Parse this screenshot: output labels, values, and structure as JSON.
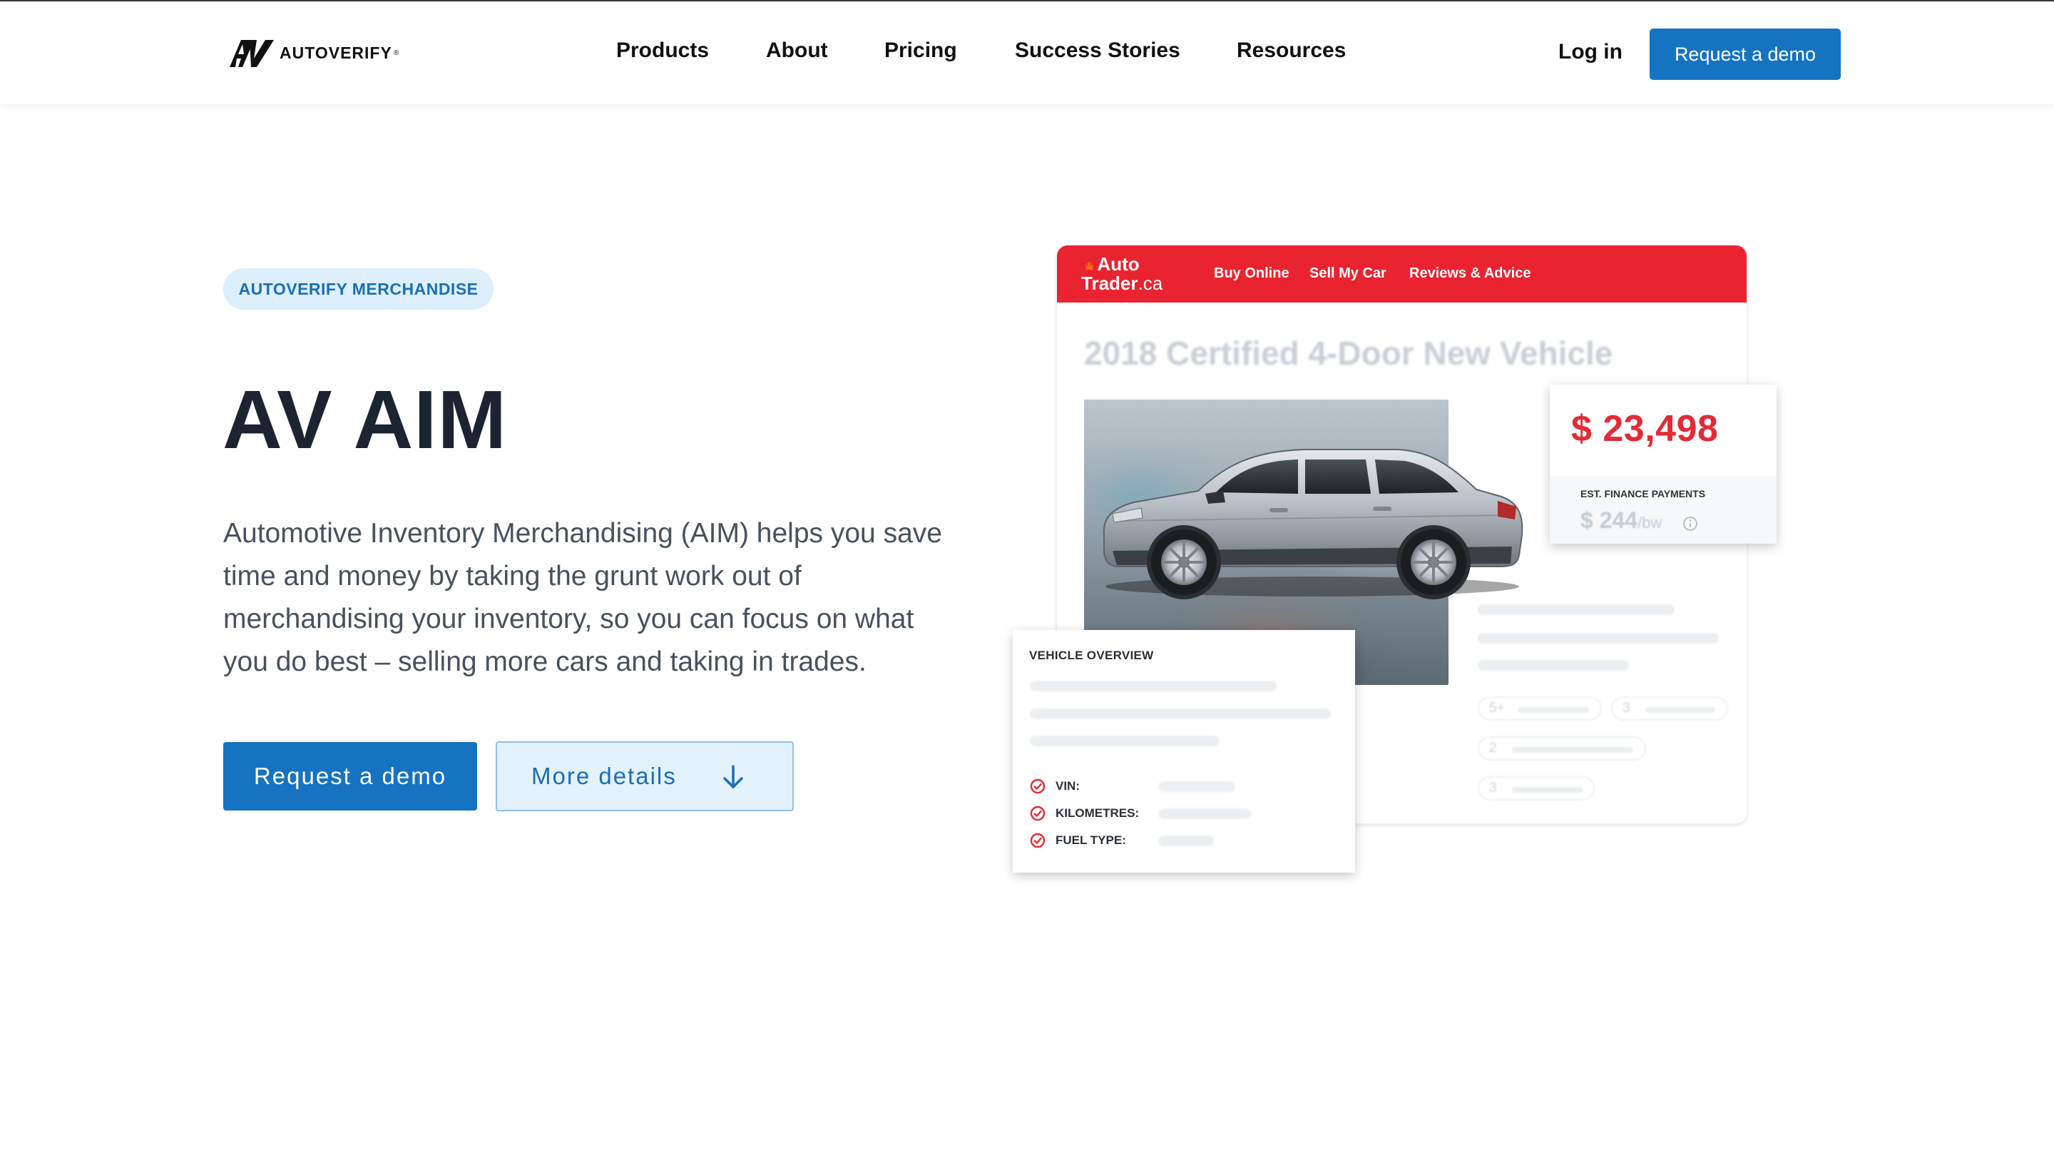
{
  "header": {
    "brand": "AUTOVERIFY",
    "nav": [
      {
        "label": "Products"
      },
      {
        "label": "About"
      },
      {
        "label": "Pricing"
      },
      {
        "label": "Success Stories"
      },
      {
        "label": "Resources"
      }
    ],
    "login_label": "Log in",
    "demo_label": "Request a demo"
  },
  "hero": {
    "badge": "AUTOVERIFY MERCHANDISE",
    "title": "AV AIM",
    "description": "Automotive Inventory Merchandising (AIM) helps you save time and money by taking the grunt work out of merchandising your inventory, so you can focus on what you do best – selling more cars and taking in trades.",
    "primary_button": "Request a demo",
    "secondary_button": "More details",
    "secondary_icon": "arrow-down-icon"
  },
  "illustration": {
    "site_logo_line1": "Auto",
    "site_logo_line2": "Trader",
    "site_logo_suffix": ".ca",
    "site_links": [
      "Buy Online",
      "Sell My Car",
      "Reviews & Advice"
    ],
    "listing_title": "2018 Certified 4-Door New Vehicle",
    "price": "$ 23,498",
    "finance_label": "EST. FINANCE PAYMENTS",
    "finance_value": "$ 244",
    "finance_unit": "/bw",
    "spec_pills": [
      "5+",
      "3",
      "2",
      "3"
    ],
    "overview_title": "VEHICLE OVERVIEW",
    "overview_rows": [
      "VIN:",
      "KILOMETRES:",
      "FUEL TYPE:"
    ],
    "colors": {
      "autotrader_red": "#ea2330",
      "price_red": "#e32a35",
      "brand_blue": "#1573c1"
    }
  }
}
